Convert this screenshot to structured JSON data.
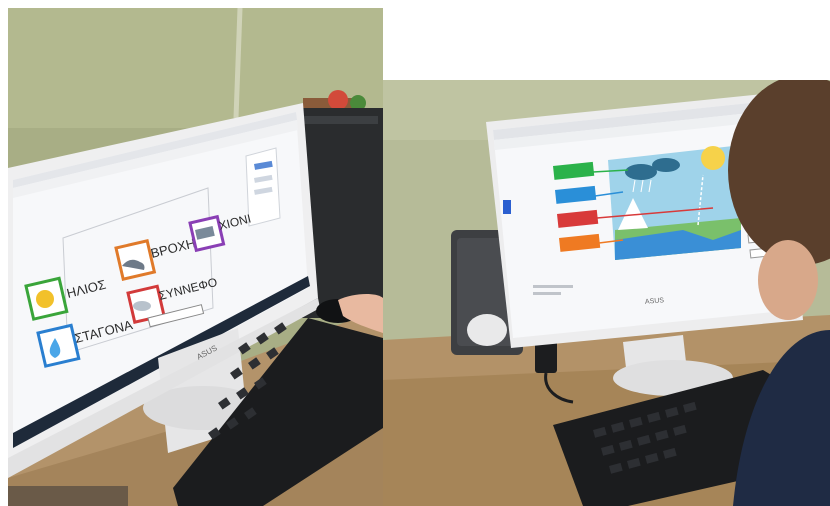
{
  "left_photo": {
    "screen": {
      "cards": [
        {
          "label": "ΗΛΙΟΣ",
          "icon": "sun-card-icon",
          "color": "#3aa53a"
        },
        {
          "label": "ΒΡΟΧΗ",
          "icon": "rain-card-icon",
          "color": "#e07a2a"
        },
        {
          "label": "ΧΙΟΝΙ",
          "icon": "snow-card-icon",
          "color": "#8a3fb5"
        },
        {
          "label": "ΣΤΑΓΟΝΑ",
          "icon": "drop-card-icon",
          "color": "#2a7fd0"
        },
        {
          "label": "ΣΥΝΝΕΦΟ",
          "icon": "cloud-card-icon",
          "color": "#d23a3a"
        }
      ]
    },
    "monitor_brand": "ASUS"
  },
  "right_photo": {
    "screen": {
      "diagram_labels": [
        {
          "color": "#2bb24a"
        },
        {
          "color": "#2a8fd8"
        },
        {
          "color": "#d83a3a"
        },
        {
          "color": "#ef7a22"
        }
      ]
    },
    "monitor_brand": "ASUS"
  }
}
